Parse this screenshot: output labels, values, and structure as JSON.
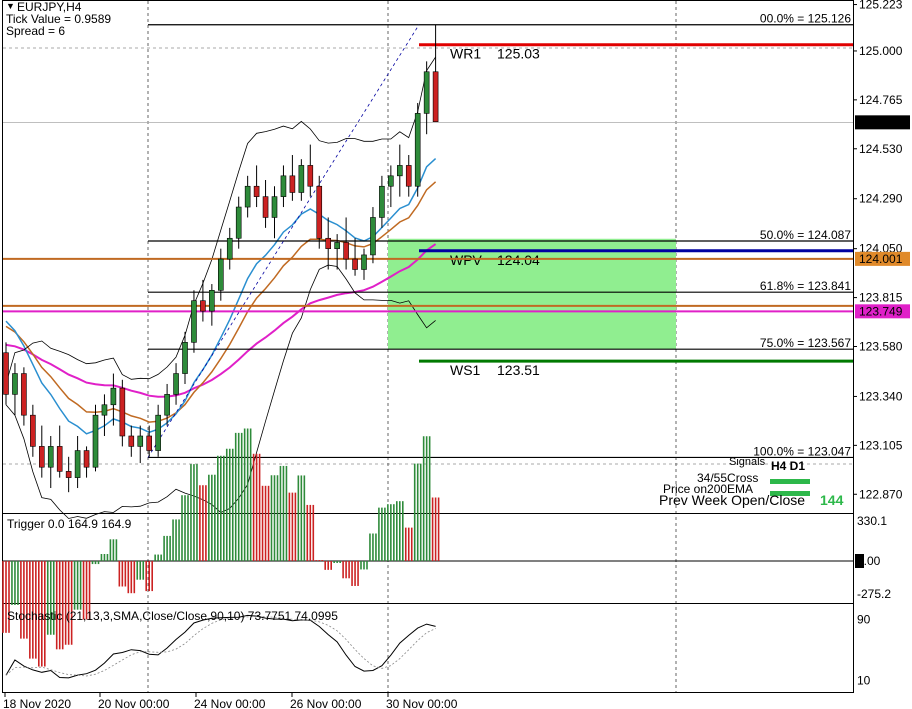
{
  "window": {
    "title": "EURJPY,H4",
    "tick_value_text": "Tick Value = 0.9589",
    "spread_text": "Spread = 6",
    "menu_icon": "triangle-down-icon"
  },
  "colors": {
    "bull": "#2e8b3a",
    "bear": "#cc2222",
    "fib": "#000000",
    "resistance": "#e00000",
    "pivot": "#0000a0",
    "support": "#007a00",
    "zone": "#90ee90",
    "ma_fast": "#2a8fd0",
    "ma_slow": "#c06a22",
    "ma_long": "#e020c8",
    "bands": "#000000"
  },
  "main": {
    "price_axis": [
      "125.223",
      "125.000",
      "124.765",
      "124.530",
      "124.290",
      "124.050",
      "123.815",
      "123.580",
      "123.340",
      "123.105",
      "122.870"
    ],
    "current_price": "124.657",
    "price_tags": [
      "124.001",
      "123.749"
    ],
    "fib_levels": [
      {
        "text": "00.0% = 125.126",
        "price": 125.126
      },
      {
        "text": "50.0% = 124.087",
        "price": 124.087
      },
      {
        "text": "61.8% = 123.841",
        "price": 123.841
      },
      {
        "text": "75.0% = 123.567",
        "price": 123.567
      },
      {
        "text": "100.0% = 123.047",
        "price": 123.047
      }
    ],
    "pivots": [
      {
        "name": "WR1",
        "value": "125.03",
        "price": 125.03,
        "kind": "resistance"
      },
      {
        "name": "WPV",
        "value": "124.04",
        "price": 124.04,
        "kind": "pivot"
      },
      {
        "name": "WS1",
        "value": "123.51",
        "price": 123.51,
        "kind": "support"
      }
    ],
    "signals": {
      "header": "Signals",
      "timeframes": "H4 D1",
      "rows": [
        "34/55Cross",
        "Price on200EMA",
        "Prev Week Open/Close"
      ],
      "count": "144"
    }
  },
  "chart_data": {
    "type": "candlestick",
    "symbol": "EURJPY,H4",
    "ylim": [
      122.78,
      125.24
    ],
    "x_labels": [
      "18 Nov 2020",
      "20 Nov 00:00",
      "24 Nov 00:00",
      "26 Nov 00:00",
      "30 Nov 00:00"
    ],
    "candles": [
      [
        123.55,
        123.6,
        123.3,
        123.35
      ],
      [
        123.35,
        123.5,
        123.25,
        123.45
      ],
      [
        123.45,
        123.48,
        123.2,
        123.25
      ],
      [
        123.25,
        123.3,
        123.05,
        123.1
      ],
      [
        123.1,
        123.2,
        122.95,
        123.0
      ],
      [
        123.0,
        123.15,
        122.9,
        123.1
      ],
      [
        123.1,
        123.2,
        122.95,
        122.98
      ],
      [
        122.98,
        123.05,
        122.88,
        122.95
      ],
      [
        122.95,
        123.15,
        122.9,
        123.08
      ],
      [
        123.08,
        123.1,
        122.95,
        123.0
      ],
      [
        123.0,
        123.3,
        122.98,
        123.25
      ],
      [
        123.25,
        123.35,
        123.15,
        123.3
      ],
      [
        123.3,
        123.45,
        123.2,
        123.38
      ],
      [
        123.38,
        123.42,
        123.1,
        123.15
      ],
      [
        123.15,
        123.2,
        123.05,
        123.1
      ],
      [
        123.1,
        123.2,
        123.02,
        123.15
      ],
      [
        123.15,
        123.2,
        123.05,
        123.08
      ],
      [
        123.08,
        123.3,
        123.05,
        123.25
      ],
      [
        123.25,
        123.4,
        123.2,
        123.35
      ],
      [
        123.35,
        123.5,
        123.3,
        123.45
      ],
      [
        123.45,
        123.65,
        123.4,
        123.6
      ],
      [
        123.6,
        123.85,
        123.55,
        123.8
      ],
      [
        123.8,
        123.9,
        123.7,
        123.75
      ],
      [
        123.75,
        123.88,
        123.68,
        123.85
      ],
      [
        123.85,
        124.05,
        123.8,
        124.0
      ],
      [
        124.0,
        124.15,
        123.95,
        124.1
      ],
      [
        124.1,
        124.3,
        124.05,
        124.25
      ],
      [
        124.25,
        124.4,
        124.2,
        124.35
      ],
      [
        124.35,
        124.45,
        124.25,
        124.3
      ],
      [
        124.3,
        124.38,
        124.15,
        124.2
      ],
      [
        124.2,
        124.35,
        124.1,
        124.3
      ],
      [
        124.3,
        124.45,
        124.25,
        124.4
      ],
      [
        124.4,
        124.5,
        124.28,
        124.32
      ],
      [
        124.32,
        124.48,
        124.28,
        124.45
      ],
      [
        124.45,
        124.55,
        124.3,
        124.35
      ],
      [
        124.35,
        124.4,
        124.05,
        124.1
      ],
      [
        124.1,
        124.2,
        123.95,
        124.05
      ],
      [
        124.05,
        124.12,
        123.95,
        124.08
      ],
      [
        124.08,
        124.2,
        123.95,
        124.0
      ],
      [
        124.0,
        124.1,
        123.92,
        123.95
      ],
      [
        123.95,
        124.05,
        123.9,
        124.02
      ],
      [
        124.02,
        124.25,
        123.98,
        124.2
      ],
      [
        124.2,
        124.4,
        124.15,
        124.35
      ],
      [
        124.35,
        124.45,
        124.25,
        124.4
      ],
      [
        124.4,
        124.55,
        124.3,
        124.45
      ],
      [
        124.45,
        124.5,
        124.3,
        124.35
      ],
      [
        124.35,
        124.75,
        124.3,
        124.7
      ],
      [
        124.7,
        124.95,
        124.6,
        124.9
      ],
      [
        124.9,
        125.126,
        124.8,
        124.66
      ]
    ]
  },
  "trigger_panel": {
    "title": "Trigger 0.0 164.9 164.9",
    "axis": [
      "330.1",
      "0.00",
      "-275.2"
    ]
  },
  "stochastic_panel": {
    "title": "Stochastic (21,13,3,SMA,Close/Close,90,10) 73.7751 74.0995",
    "axis": [
      "90",
      "10"
    ]
  },
  "time_axis": [
    "18 Nov 2020",
    "20 Nov 00:00",
    "24 Nov 00:00",
    "26 Nov 00:00",
    "30 Nov 00:00"
  ]
}
